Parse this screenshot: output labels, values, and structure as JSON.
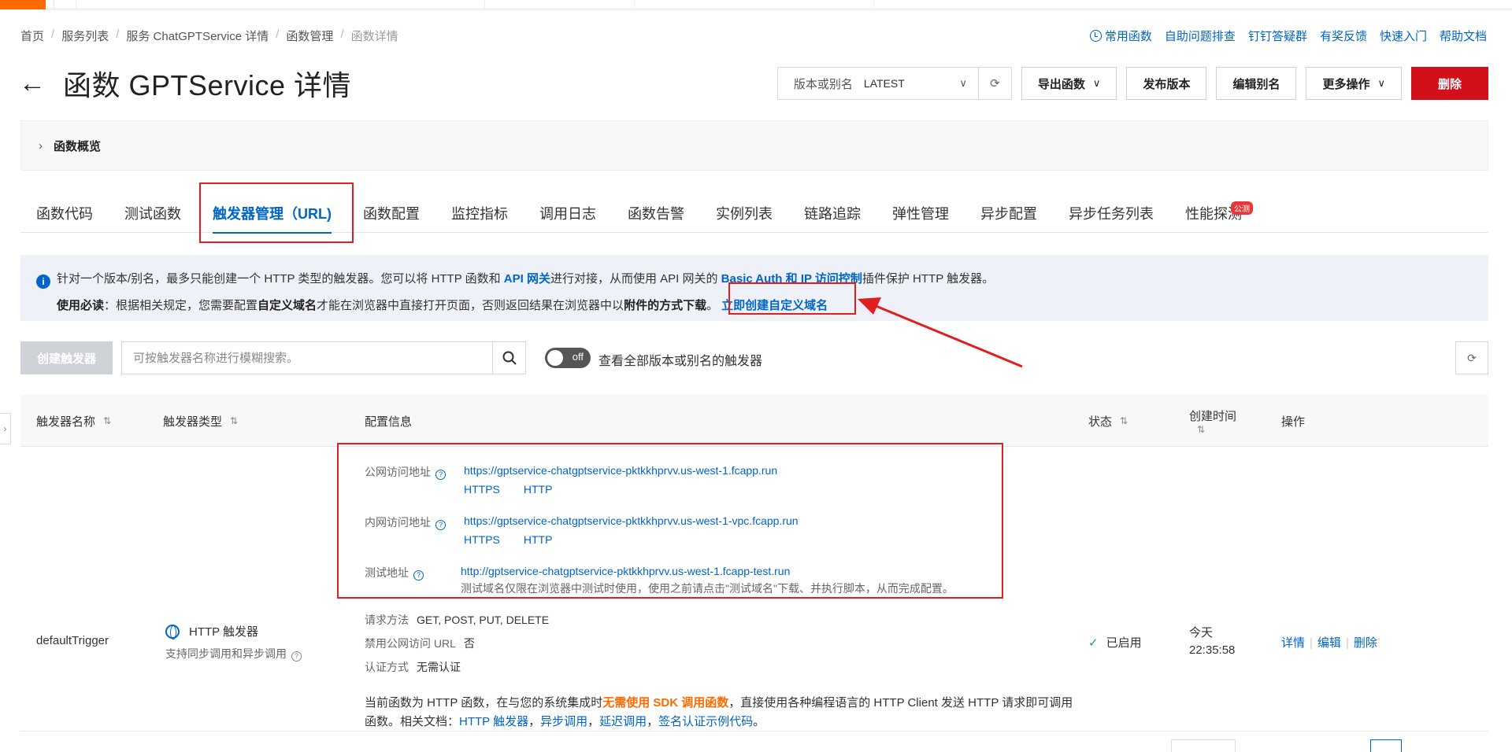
{
  "breadcrumb": [
    "首页",
    "服务列表",
    "服务 ChatGPTService 详情",
    "函数管理",
    "函数详情"
  ],
  "help_links": [
    "常用函数",
    "自助问题排查",
    "钉钉答疑群",
    "有奖反馈",
    "快速入门",
    "帮助文档"
  ],
  "title": "函数 GPTService 详情",
  "version": {
    "label": "版本或别名",
    "value": "LATEST"
  },
  "actions": {
    "export": "导出函数",
    "publish": "发布版本",
    "alias": "编辑别名",
    "more": "更多操作",
    "delete": "删除"
  },
  "overview_label": "函数概览",
  "tabs": [
    "函数代码",
    "测试函数",
    "触发器管理（URL)",
    "函数配置",
    "监控指标",
    "调用日志",
    "函数告警",
    "实例列表",
    "链路追踪",
    "弹性管理",
    "异步配置",
    "异步任务列表",
    "性能探测"
  ],
  "tab_badge": "公测",
  "notice": {
    "p1_a": "针对一个版本/别名，最多只能创建一个 HTTP 类型的触发器。您可以将 HTTP 函数和 ",
    "p1_link1": "API 网关",
    "p1_b": "进行对接，从而使用 API 网关的 ",
    "p1_link2": "Basic Auth",
    "p1_c": " 和 ",
    "p1_link3": "IP 访问控制",
    "p1_d": "插件保护 HTTP 触发器。",
    "p2_bold1": "使用必读",
    "p2_a": "：根据相关规定，您需要配置",
    "p2_bold2": "自定义域名",
    "p2_b": "才能在浏览器中直接打开页面，否则返回结果在浏览器中以",
    "p2_bold3": "附件的方式下载",
    "p2_c": "。",
    "p2_cta": "立即创建自定义域名"
  },
  "toolbar": {
    "create": "创建触发器",
    "search_placeholder": "可按触发器名称进行模糊搜索。",
    "toggle_text": "off",
    "toggle_label": "查看全部版本或别名的触发器"
  },
  "table": {
    "headers": {
      "name": "触发器名称",
      "type": "触发器类型",
      "config": "配置信息",
      "status": "状态",
      "created_1": "创建时间",
      "ops": "操作"
    },
    "row": {
      "name": "defaultTrigger",
      "type": "HTTP 触发器",
      "type_sub": "支持同步调用和异步调用",
      "public_label": "公网访问地址",
      "public_url": "https://gptservice-chatgptservice-pktkkhprvv.us-west-1.fcapp.run",
      "intranet_label": "内网访问地址",
      "intranet_url": "https://gptservice-chatgptservice-pktkkhprvv.us-west-1-vpc.fcapp.run",
      "proto_https": "HTTPS",
      "proto_http": "HTTP",
      "test_label": "测试地址",
      "test_url": "http://gptservice-chatgptservice-pktkkhprvv.us-west-1.fcapp-test.run",
      "test_note": "测试域名仅限在浏览器中测试时使用，使用之前请点击\"测试域名\"下载、并执行脚本，从而完成配置。",
      "methods_label": "请求方法",
      "methods": "GET, POST, PUT, DELETE",
      "disable_label": "禁用公网访问 URL",
      "disable_value": "否",
      "auth_label": "认证方式",
      "auth_value": "无需认证",
      "desc_a": "当前函数为 HTTP 函数，在与您的系统集成时",
      "desc_orange": "无需使用 SDK 调用函数",
      "desc_b": "，直接使用各种编程语言的 HTTP Client 发送 HTTP 请求即可调用函数。相关文档：",
      "doc1": "HTTP 触发器",
      "doc2": "异步调用",
      "doc3": "延迟调用",
      "doc4": "签名认证示例代码",
      "status": "已启用",
      "time_1": "今天",
      "time_2": "22:35:58",
      "op_detail": "详情",
      "op_edit": "编辑",
      "op_delete": "删除"
    }
  }
}
